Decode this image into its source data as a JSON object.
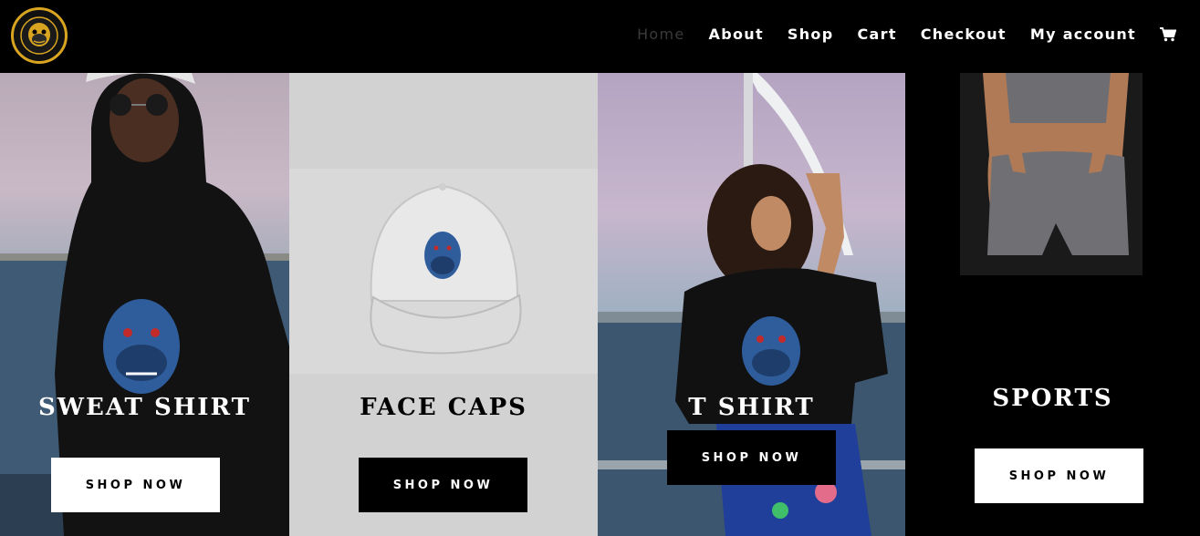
{
  "header": {
    "logo_icon": "gorilla-logo-icon",
    "nav": [
      {
        "label": "Home",
        "active": true
      },
      {
        "label": "About",
        "active": false
      },
      {
        "label": "Shop",
        "active": false
      },
      {
        "label": "Cart",
        "active": false
      },
      {
        "label": "Checkout",
        "active": false
      },
      {
        "label": "My account",
        "active": false
      }
    ],
    "cart_icon": "shopping-cart-icon"
  },
  "categories": [
    {
      "title": "SWEAT SHIRT",
      "button": "SHOP NOW"
    },
    {
      "title": "FACE CAPS",
      "button": "SHOP NOW"
    },
    {
      "title": "T SHIRT",
      "button": "SHOP NOW"
    },
    {
      "title": "SPORTS",
      "button": "SHOP NOW"
    }
  ],
  "colors": {
    "header_bg": "#000000",
    "logo_ring": "#d9a520",
    "nav_active": "#3a3a3a",
    "nav_text": "#ffffff"
  }
}
